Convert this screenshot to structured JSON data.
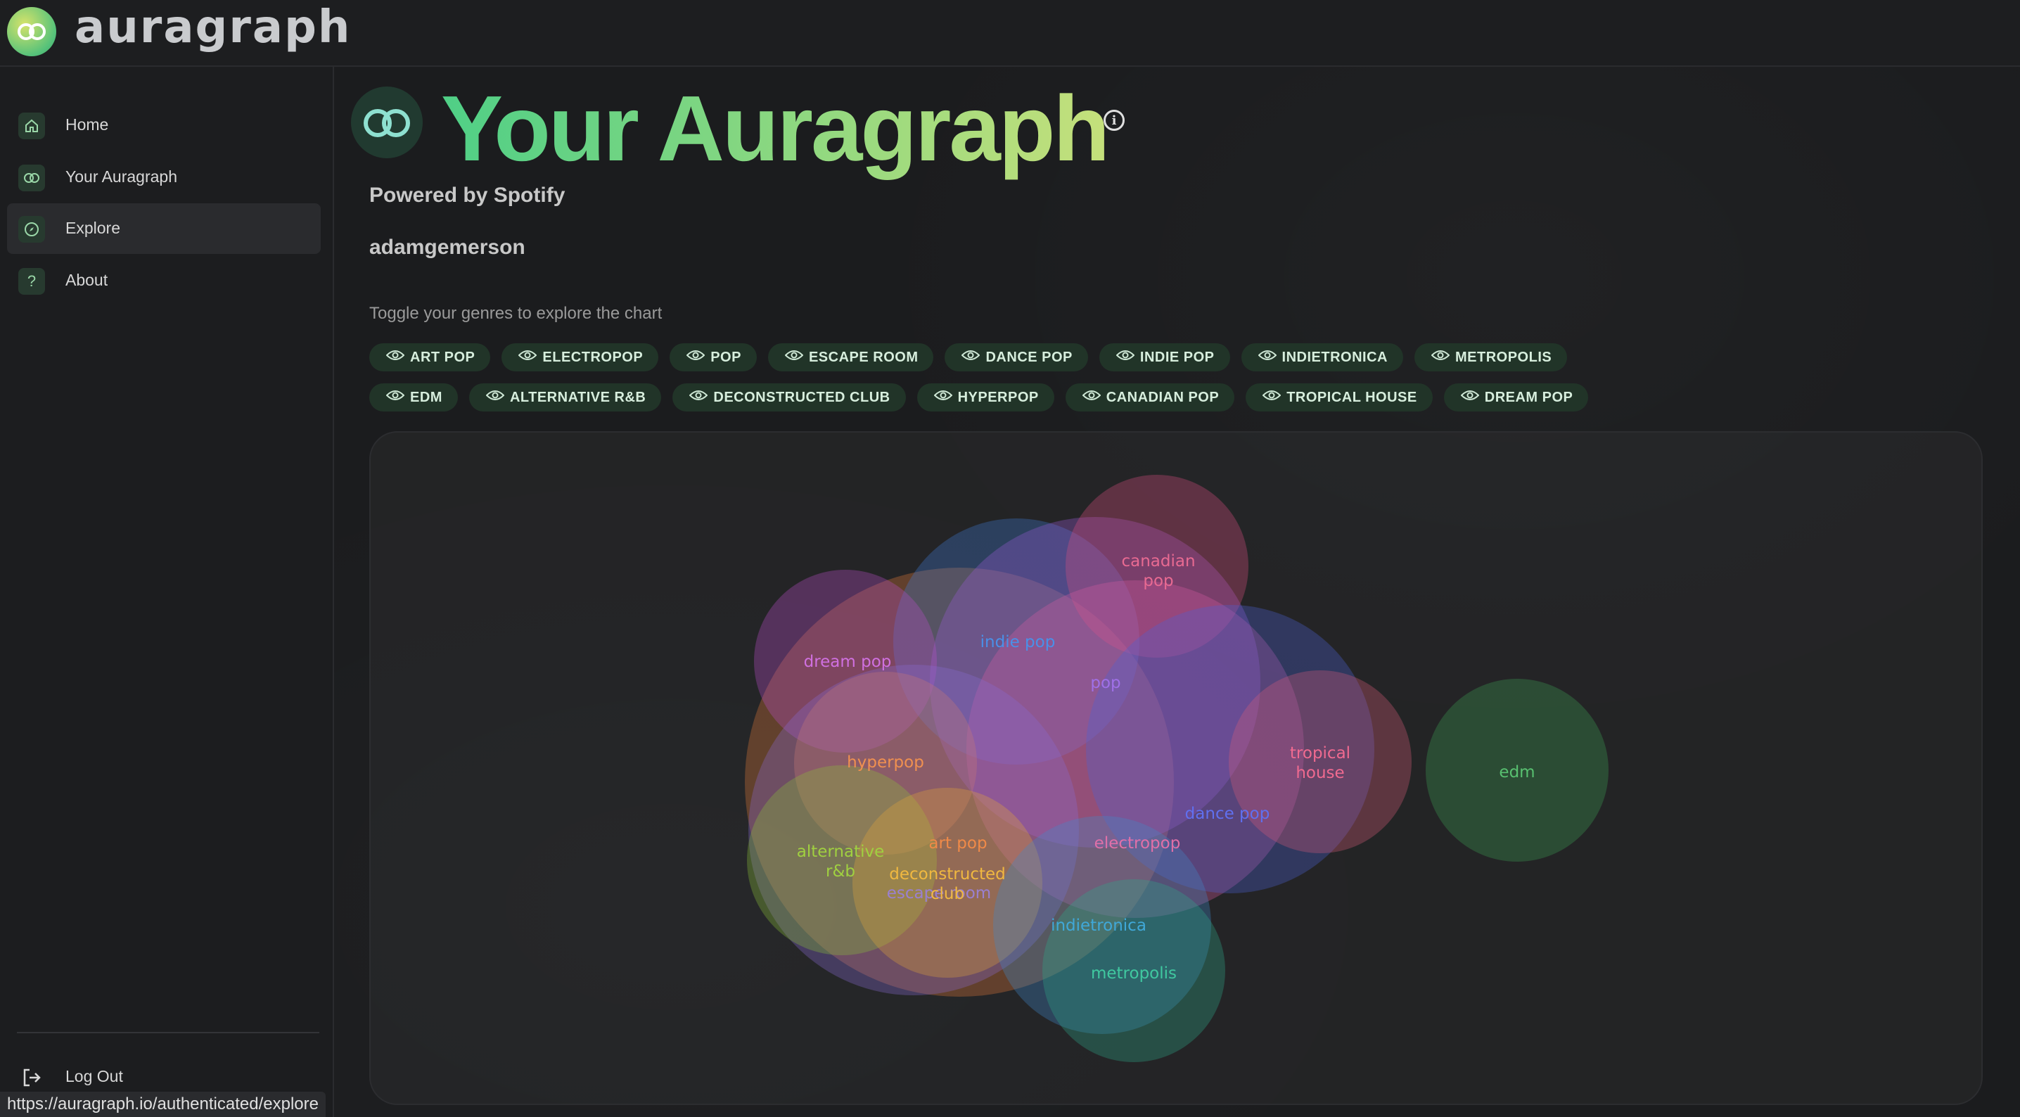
{
  "app": {
    "brand": "auragraph"
  },
  "sidebar": {
    "items": [
      {
        "label": "Home",
        "icon": "home-icon"
      },
      {
        "label": "Your Auragraph",
        "icon": "rings-icon"
      },
      {
        "label": "Explore",
        "icon": "compass-icon",
        "active": true
      },
      {
        "label": "About",
        "icon": "question-icon"
      }
    ],
    "logout": {
      "label": "Log Out",
      "icon": "logout-icon"
    }
  },
  "header": {
    "title": "Your Auragraph",
    "powered_by": "Powered by Spotify",
    "username": "adamgemerson",
    "toggle_hint": "Toggle your genres to explore the chart"
  },
  "genre_chips": {
    "row1": [
      "ART POP",
      "ELECTROPOP",
      "POP",
      "ESCAPE ROOM",
      "DANCE POP",
      "INDIE POP",
      "INDIETRONICA",
      "METROPOLIS"
    ],
    "row2": [
      "EDM",
      "ALTERNATIVE R&B",
      "DECONSTRUCTED CLUB",
      "HYPERPOP",
      "CANADIAN POP",
      "TROPICAL HOUSE",
      "DREAM POP"
    ]
  },
  "colors": {
    "accent_green": "#4fcf86",
    "accent_yellow": "#c5e07b",
    "chip_bg": "#213428"
  },
  "chart_data": {
    "type": "bubble",
    "bubbles": [
      {
        "label": "art pop",
        "color": "#e07a3a"
      },
      {
        "label": "indie pop",
        "color": "#3f78d6"
      },
      {
        "label": "pop",
        "color": "#9c5bd8"
      },
      {
        "label": "canadian pop",
        "color": "#d9507e"
      },
      {
        "label": "dream pop",
        "color": "#b84fc8"
      },
      {
        "label": "electropop",
        "color": "#d65aa2"
      },
      {
        "label": "dance pop",
        "color": "#4d62d6"
      },
      {
        "label": "tropical house",
        "color": "#d45a7a"
      },
      {
        "label": "hyperpop",
        "color": "#e87f45"
      },
      {
        "label": "escape room",
        "color": "#8a6bd0"
      },
      {
        "label": "alternative r&b",
        "color": "#8dc03a"
      },
      {
        "label": "deconstructed club",
        "color": "#e0a53a"
      },
      {
        "label": "indietronica",
        "color": "#3f8ac8"
      },
      {
        "label": "metropolis",
        "color": "#2fa88a"
      },
      {
        "label": "edm",
        "color": "#3d9d55"
      }
    ]
  },
  "status_bar": {
    "url": "https://auragraph.io/authenticated/explore"
  }
}
